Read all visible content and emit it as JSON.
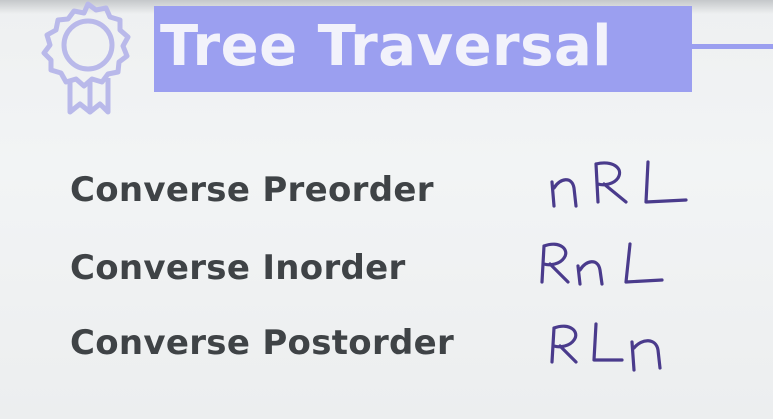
{
  "slide": {
    "title": "Tree Traversal",
    "accent_color": "#9b9ff0",
    "text_color": "#3f4346",
    "ink_color": "#4a3b8c",
    "icon": "award-ribbon-icon"
  },
  "traversals": [
    {
      "name": "Converse Preorder",
      "notation": "nRL"
    },
    {
      "name": "Converse Inorder",
      "notation": "RnL"
    },
    {
      "name": "Converse Postorder",
      "notation": "RLn"
    }
  ]
}
